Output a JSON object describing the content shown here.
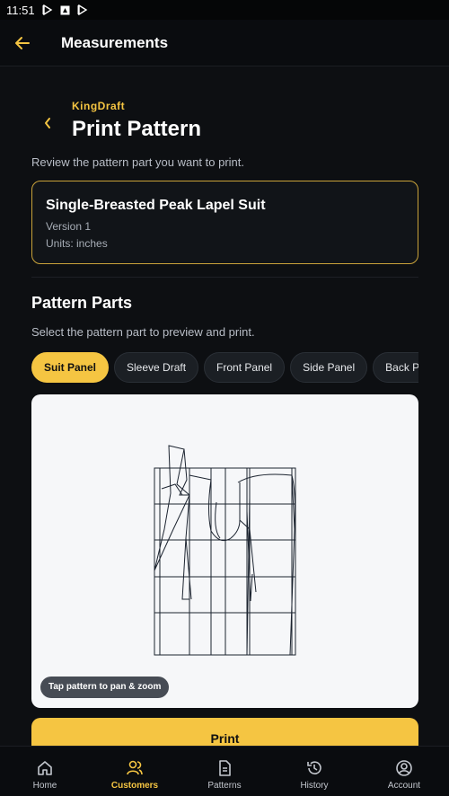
{
  "status_bar": {
    "time": "11:51"
  },
  "app_bar": {
    "title": "Measurements",
    "back_icon": "arrow-left-icon"
  },
  "header": {
    "brand": "KingDraft",
    "title": "Print Pattern",
    "subtitle": "Review the pattern part you want to print."
  },
  "pattern": {
    "name": "Single-Breasted Peak Lapel Suit",
    "version": "Version 1",
    "units": "Units: inches"
  },
  "parts_section": {
    "title": "Pattern Parts",
    "subtitle": "Select the pattern part to preview and print.",
    "chips": [
      {
        "label": "Suit Panel",
        "active": true
      },
      {
        "label": "Sleeve Draft",
        "active": false
      },
      {
        "label": "Front Panel",
        "active": false
      },
      {
        "label": "Side Panel",
        "active": false
      },
      {
        "label": "Back Panel",
        "active": false
      }
    ]
  },
  "preview": {
    "hint": "Tap pattern to pan & zoom"
  },
  "actions": {
    "print_label": "Print"
  },
  "bottom_nav": [
    {
      "label": "Home",
      "icon": "home-icon",
      "active": false
    },
    {
      "label": "Customers",
      "icon": "users-icon",
      "active": true
    },
    {
      "label": "Patterns",
      "icon": "document-icon",
      "active": false
    },
    {
      "label": "History",
      "icon": "history-icon",
      "active": false
    },
    {
      "label": "Account",
      "icon": "account-icon",
      "active": false
    }
  ],
  "colors": {
    "accent": "#f5c542",
    "background": "#0d0f12",
    "card_border": "#c9a23a"
  }
}
